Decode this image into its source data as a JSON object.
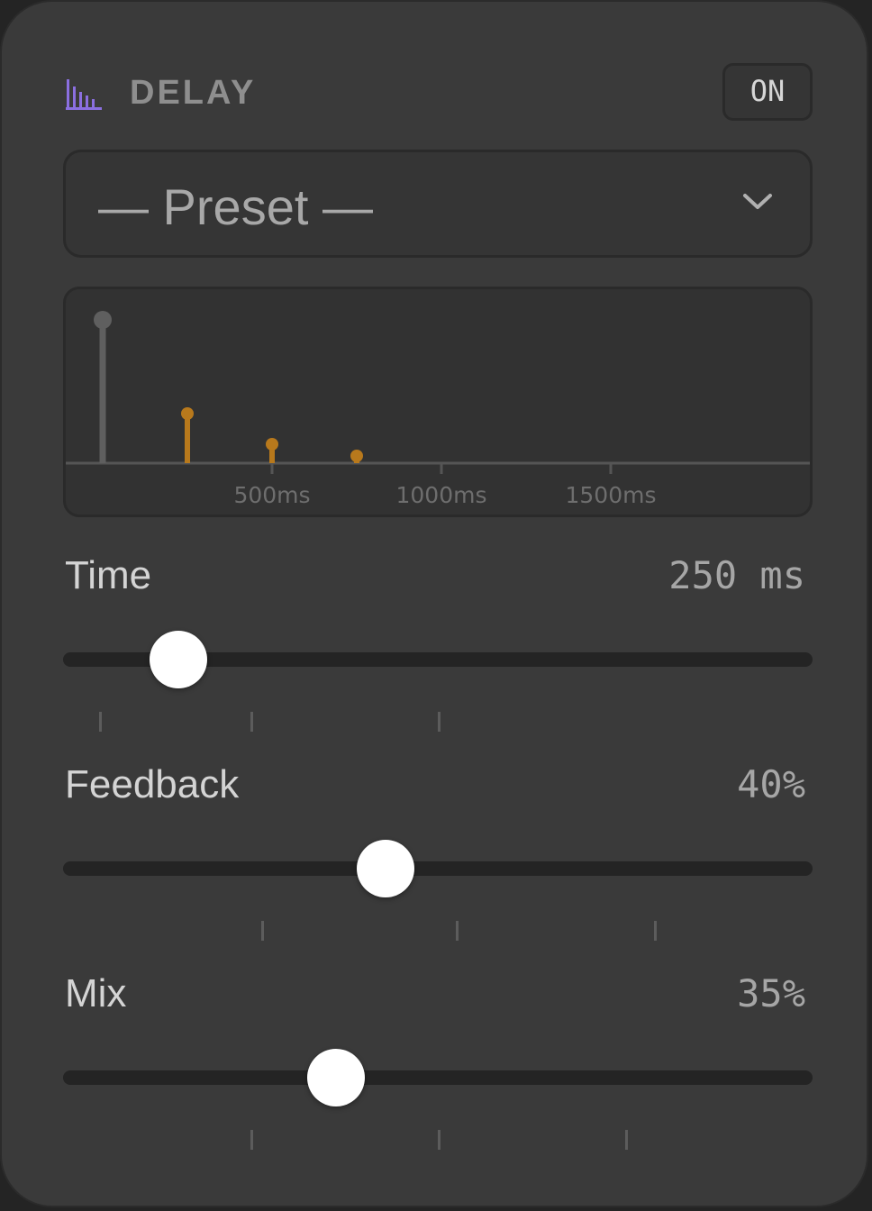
{
  "header": {
    "title": "DELAY",
    "icon": "bar-graph-icon",
    "toggle_label": "ON",
    "accent": "#8b6fe0"
  },
  "preset": {
    "label": "— Preset —"
  },
  "visualizer": {
    "axis_labels": [
      "500ms",
      "1000ms",
      "1500ms"
    ],
    "dry_color": "#5f5f5f",
    "echo_color": "#b8791c"
  },
  "controls": [
    {
      "label": "Time",
      "value": "250 ms",
      "fraction": 0.154
    },
    {
      "label": "Feedback",
      "value": "40%",
      "fraction": 0.43
    },
    {
      "label": "Mix",
      "value": "35%",
      "fraction": 0.364
    }
  ]
}
